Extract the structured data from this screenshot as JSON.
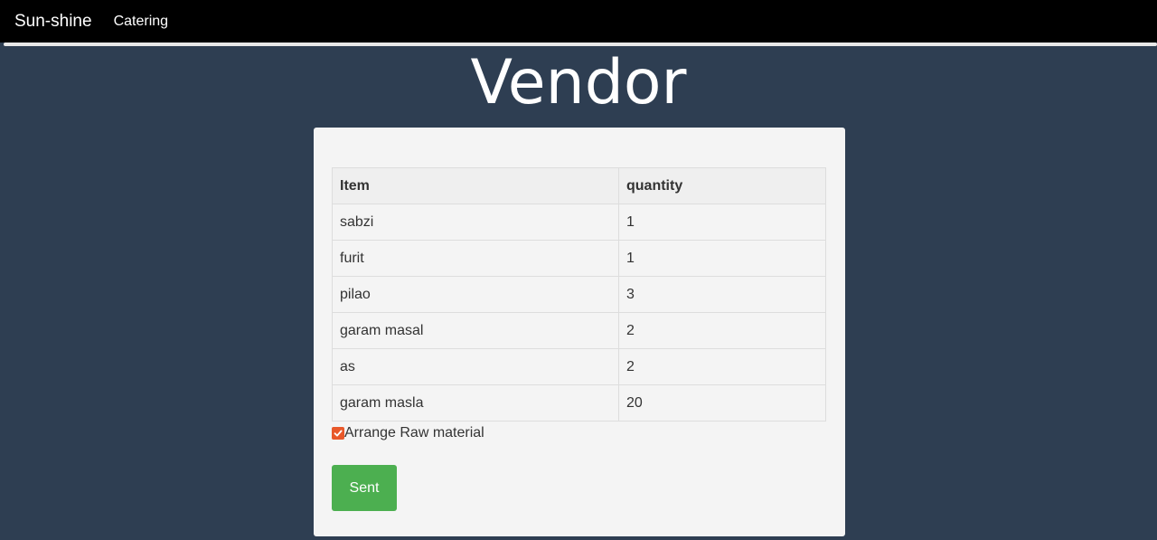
{
  "navbar": {
    "brand": "Sun-shine",
    "links": [
      "Catering"
    ]
  },
  "page": {
    "title": "Vendor"
  },
  "table": {
    "headers": [
      "Item",
      "quantity"
    ],
    "rows": [
      [
        "sabzi",
        "1"
      ],
      [
        "furit",
        "1"
      ],
      [
        "pilao",
        "3"
      ],
      [
        "garam masal",
        "2"
      ],
      [
        "as",
        "2"
      ],
      [
        "garam masla",
        "20"
      ]
    ]
  },
  "form": {
    "checkbox_label": "Arrange Raw material",
    "checkbox_checked": true,
    "submit_label": "Sent"
  },
  "colors": {
    "background": "#2e3e52",
    "navbar": "#000000",
    "checkbox_accent": "#e8582a",
    "submit_button": "#4caf50"
  }
}
